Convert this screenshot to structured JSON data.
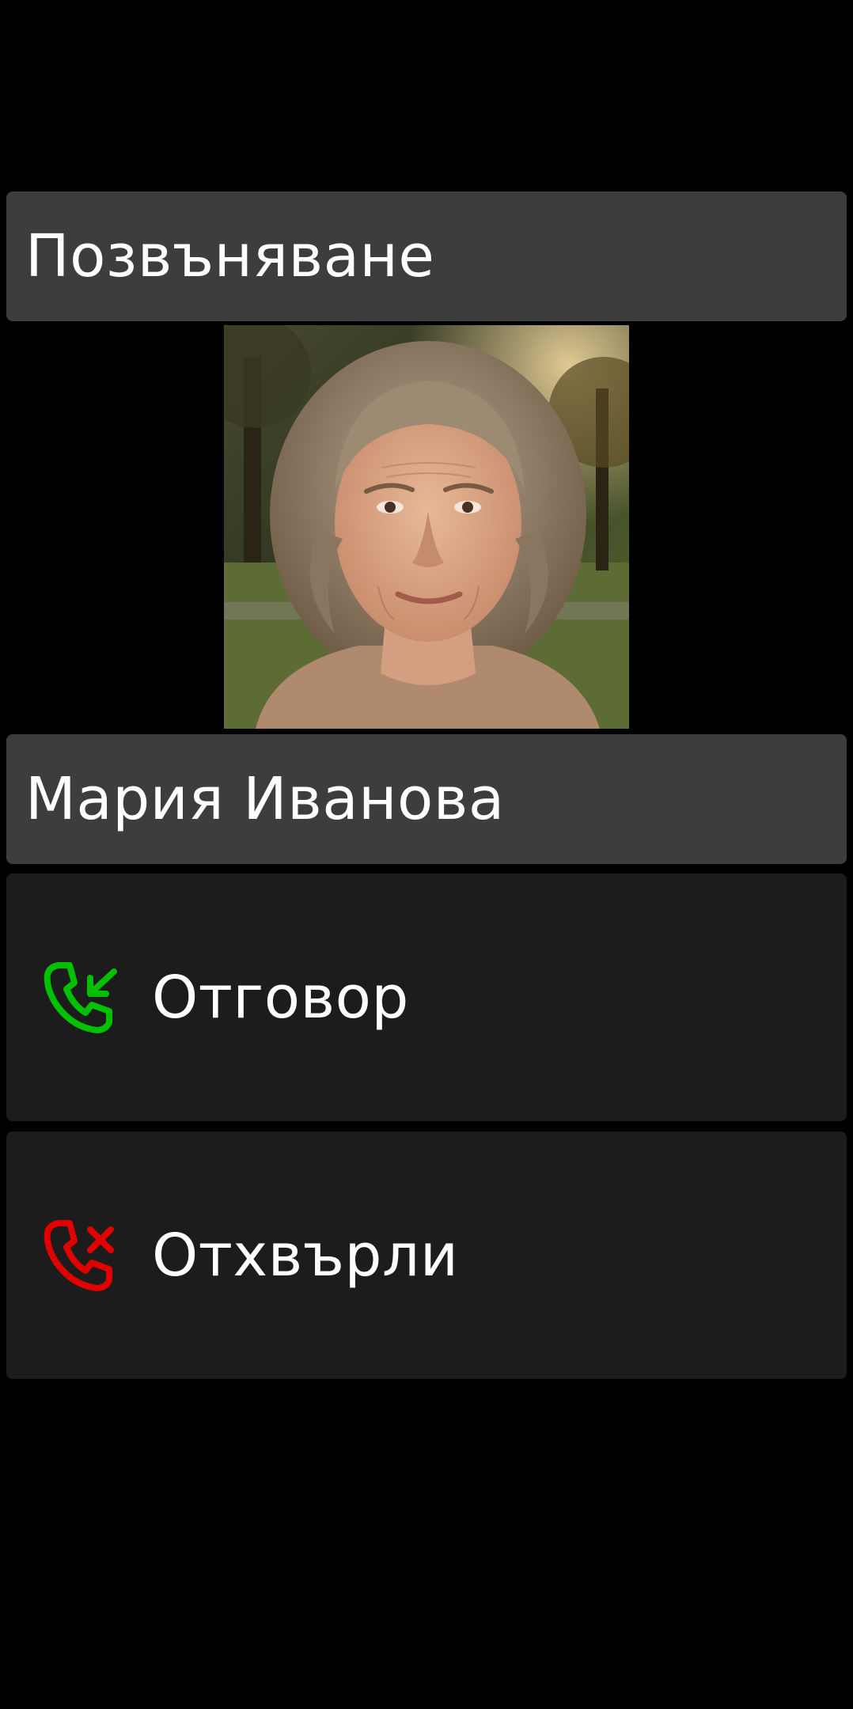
{
  "header": {
    "title": "Позвъняване"
  },
  "caller": {
    "name": "Мария Иванова",
    "photo_icon": "caller-photo"
  },
  "actions": [
    {
      "label": "Отговор",
      "icon": "phone-answer-icon",
      "color": "#00c000"
    },
    {
      "label": "Отхвърли",
      "icon": "phone-reject-icon",
      "color": "#e00000"
    }
  ],
  "colors": {
    "background": "#000000",
    "bar": "#3d3d3d",
    "action_bg": "#1c1c1c",
    "text": "#ffffff"
  }
}
